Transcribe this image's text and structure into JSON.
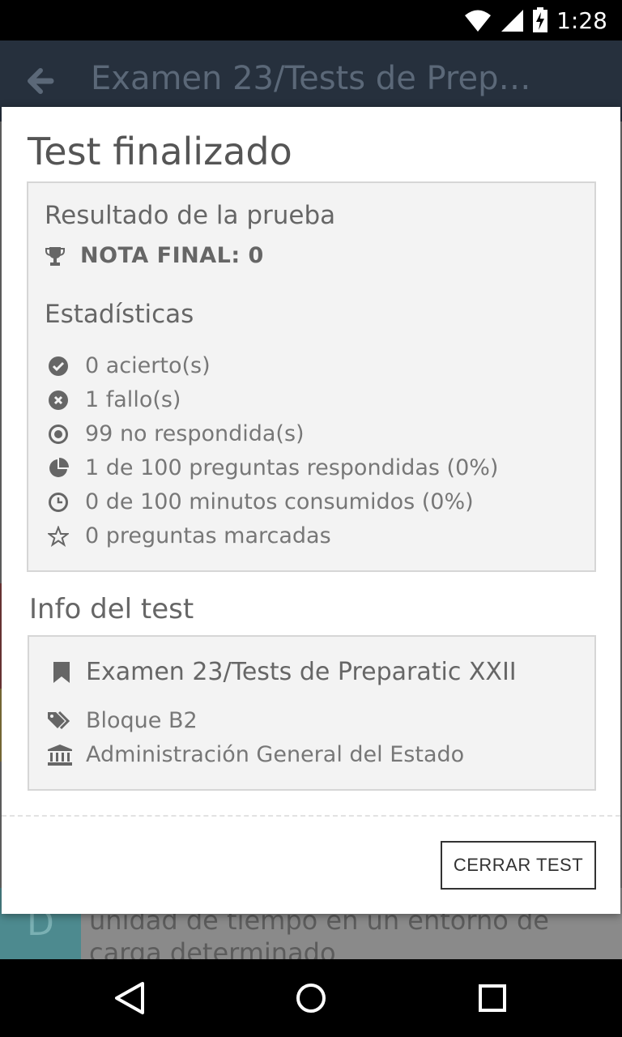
{
  "status_bar": {
    "time": "1:28",
    "icons": [
      "wifi-icon",
      "cell-signal-icon",
      "battery-charging-icon"
    ]
  },
  "app_bar": {
    "title": "Examen 23/Tests de Prepara...",
    "back_icon": "arrow-left-icon"
  },
  "background": {
    "option_letter": "D",
    "option_text": "unidad de tiempo en un entorno de carga determinado"
  },
  "dialog": {
    "title": "Test finalizado",
    "result": {
      "heading": "Resultado de la prueba",
      "nota_final": "NOTA FINAL: 0",
      "stats_heading": "Estadísticas",
      "stats": [
        {
          "icon": "check-circle-icon",
          "text": "0 acierto(s)"
        },
        {
          "icon": "x-circle-icon",
          "text": "1 fallo(s)"
        },
        {
          "icon": "dot-circle-icon",
          "text": "99 no respondida(s)"
        },
        {
          "icon": "pie-chart-icon",
          "text": "1 de 100 preguntas respondidas (0%)"
        },
        {
          "icon": "clock-icon",
          "text": "0 de 100 minutos consumidos (0%)"
        },
        {
          "icon": "star-outline-icon",
          "text": "0 preguntas marcadas"
        }
      ]
    },
    "info": {
      "heading": "Info del test",
      "title": "Examen 23/Tests de Preparatic XXII",
      "tag": "Bloque B2",
      "institution": "Administración General del Estado"
    },
    "close_button": "CERRAR TEST"
  },
  "nav_bar": {
    "back": "back-triangle-icon",
    "home": "home-circle-icon",
    "recents": "recents-square-icon"
  }
}
